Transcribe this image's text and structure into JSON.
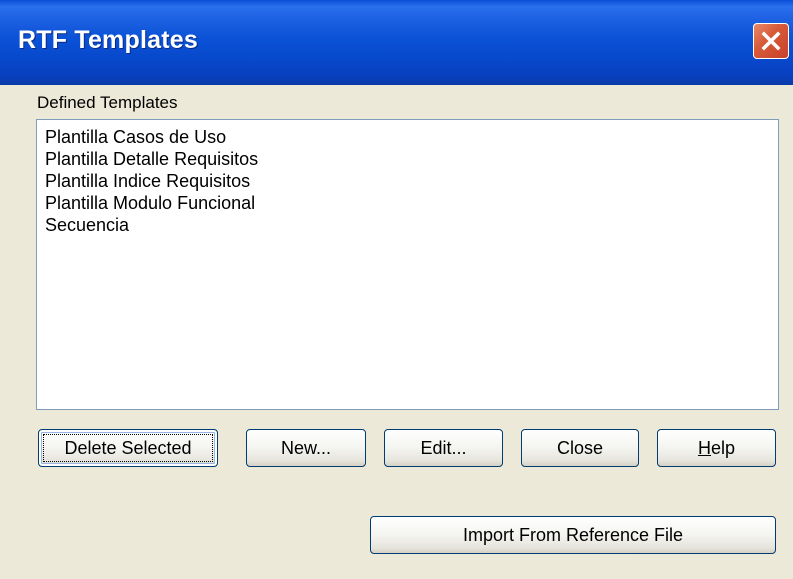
{
  "window": {
    "title": "RTF Templates"
  },
  "templates": {
    "group_label": "Defined Templates",
    "items": [
      "Plantilla Casos de Uso",
      "Plantilla Detalle Requisitos",
      "Plantilla Indice Requisitos",
      "Plantilla Modulo Funcional",
      "Secuencia"
    ]
  },
  "buttons": {
    "delete_selected": "Delete Selected",
    "new": "New...",
    "edit": "Edit...",
    "close": "Close",
    "help_mnemonic": "H",
    "help_rest": "elp",
    "import": "Import From Reference File"
  },
  "icons": {
    "close": "close-icon"
  },
  "colors": {
    "titlebar": "#0a52d6",
    "close_button": "#d85b3a",
    "dialog_background": "#ece9d8",
    "listbox_border": "#7f9db9",
    "button_border": "#003c74"
  }
}
